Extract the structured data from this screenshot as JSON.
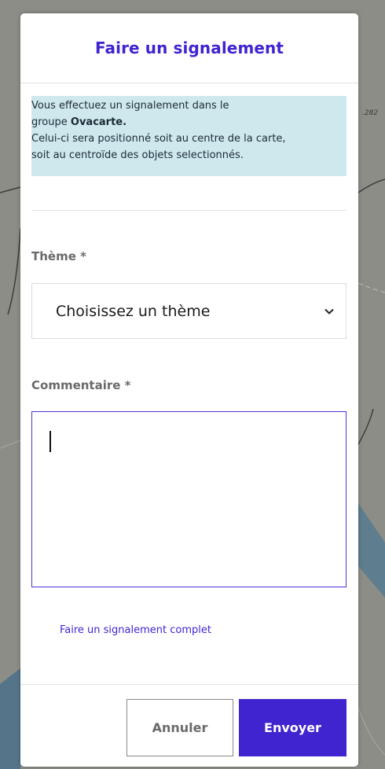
{
  "map": {
    "scale_label": ".282"
  },
  "modal": {
    "title": "Faire un signalement",
    "info": {
      "line1": "Vous effectuez un signalement dans le",
      "line2_prefix": "groupe ",
      "group_name": "Ovacarte.",
      "line3": "Celui-ci sera positionné soit au centre de la carte,",
      "line4": "soit au centroïde des objets selectionnés."
    },
    "theme": {
      "label": "Thème *",
      "selected": "Choisissez un thème"
    },
    "comment": {
      "label": "Commentaire *",
      "value": ""
    },
    "full_report_link": "Faire un signalement complet",
    "buttons": {
      "cancel": "Annuler",
      "send": "Envoyer"
    }
  },
  "colors": {
    "accent": "#3f24d0",
    "info_bg": "#cfe8ee"
  }
}
